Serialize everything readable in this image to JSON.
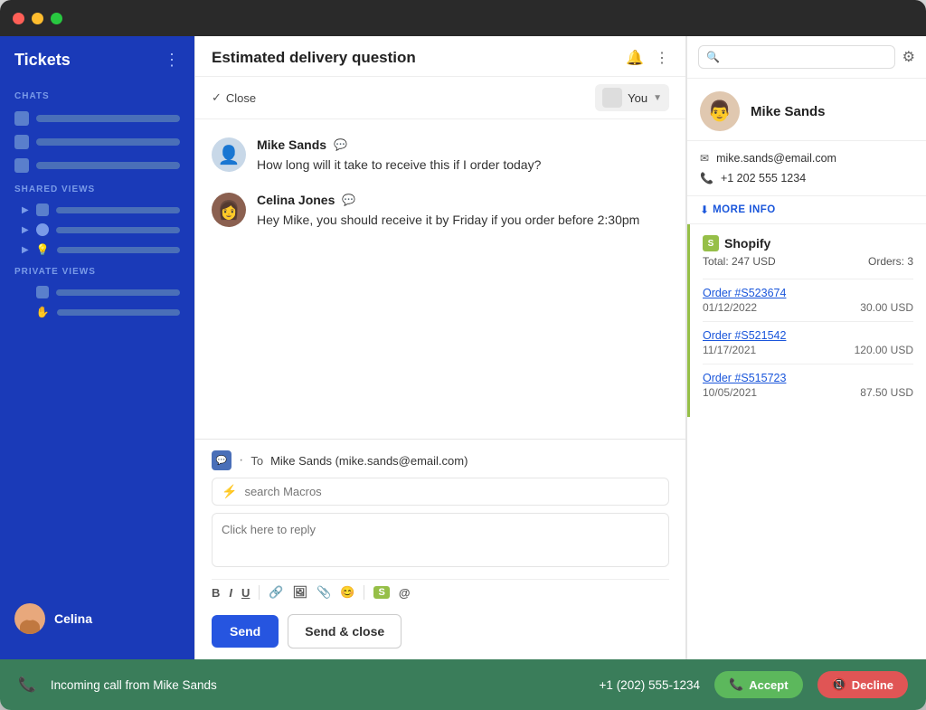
{
  "window": {
    "title": "Tickets"
  },
  "sidebar": {
    "title": "Tickets",
    "sections": [
      {
        "label": "CHATS",
        "items": [
          {
            "bar_width": "70%"
          },
          {
            "bar_width": "60%"
          },
          {
            "bar_width": "50%"
          }
        ]
      },
      {
        "label": "SHARED VIEWS",
        "items": [
          {
            "bar_width": "65%"
          },
          {
            "bar_width": "55%"
          },
          {
            "bar_width": "60%"
          }
        ]
      },
      {
        "label": "PRIVATE VIEWS",
        "items": [
          {
            "bar_width": "60%"
          },
          {
            "bar_width": "55%"
          }
        ]
      }
    ],
    "footer": {
      "name": "Celina"
    }
  },
  "ticket": {
    "title": "Estimated delivery question",
    "assignee": "You",
    "close_label": "Close"
  },
  "messages": [
    {
      "sender": "Mike Sands",
      "text": "How long will it take to receive this if I order today?",
      "avatar": "mike"
    },
    {
      "sender": "Celina Jones",
      "text": "Hey Mike, you should receive it by Friday if you order before 2:30pm",
      "avatar": "celina"
    }
  ],
  "reply": {
    "to_label": "To",
    "to_value": "Mike Sands (mike.sands@email.com)",
    "macro_placeholder": "search Macros",
    "textarea_placeholder": "Click here to reply",
    "send_label": "Send",
    "send_close_label": "Send & close",
    "toolbar": {
      "bold": "B",
      "italic": "I",
      "underline": "U",
      "link": "⌘",
      "image": "⬜",
      "attach": "📎",
      "emoji": "😊",
      "shopify_icon": "S",
      "mention": "@"
    }
  },
  "right_panel": {
    "search_placeholder": "",
    "contact": {
      "name": "Mike Sands",
      "email": "mike.sands@email.com",
      "phone": "+1 202 555 1234"
    },
    "more_info_label": "MORE INFO",
    "shopify": {
      "name": "Shopify",
      "total": "Total: 247 USD",
      "orders_count": "Orders: 3",
      "orders": [
        {
          "id": "Order #S523674",
          "date": "01/12/2022",
          "amount": "30.00 USD"
        },
        {
          "id": "Order #S521542",
          "date": "11/17/2021",
          "amount": "120.00 USD"
        },
        {
          "id": "Order #S515723",
          "date": "10/05/2021",
          "amount": "87.50 USD"
        }
      ]
    }
  },
  "bottom_bar": {
    "call_text": "Incoming call from Mike Sands",
    "phone_number": "+1 (202) 555-1234",
    "accept_label": "Accept",
    "decline_label": "Decline"
  }
}
